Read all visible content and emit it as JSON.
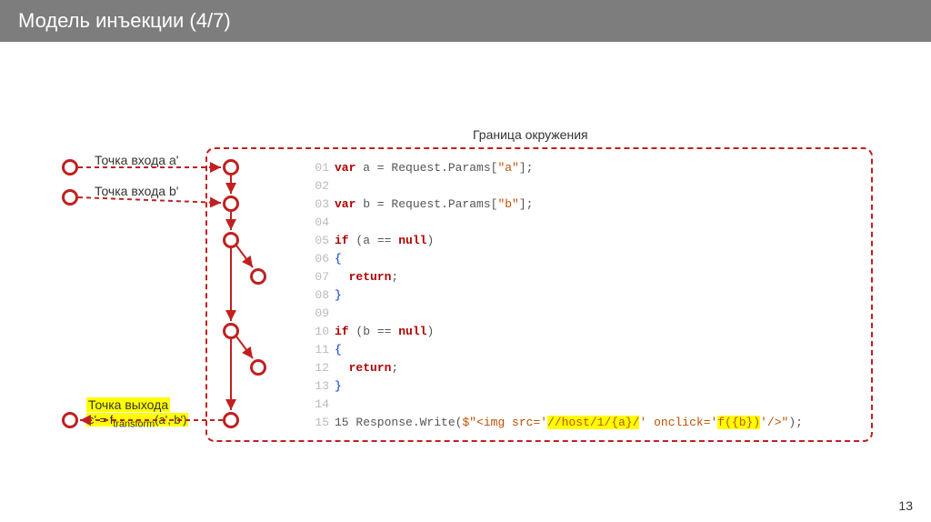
{
  "header": {
    "title": "Модель инъекции (4/7)"
  },
  "slide_number": "13",
  "boundary_label": "Граница окружения",
  "labels": {
    "entry_a": "Точка входа a'",
    "entry_b": "Точка входа b'",
    "exit_c": "Точка выхода",
    "exit_formula": "c' = ftransform(a', b')"
  },
  "code": {
    "l01_a": "01 ",
    "l01_kw": "var",
    "l01_b": " a = Request.Params[",
    "l01_str": "\"a\"",
    "l01_c": "];",
    "l02": "02",
    "l03_a": "03 ",
    "l03_kw": "var",
    "l03_b": " b = Request.Params[",
    "l03_str": "\"b\"",
    "l03_c": "];",
    "l04": "04",
    "l05_a": "05 ",
    "l05_kw": "if",
    "l05_b": " (a == ",
    "l05_kw2": "null",
    "l05_c": ")",
    "l06_a": "06 ",
    "l06_brace": "{",
    "l07_a": "07   ",
    "l07_kw": "return",
    "l07_b": ";",
    "l08_a": "08 ",
    "l08_brace": "}",
    "l09": "09",
    "l10_a": "10 ",
    "l10_kw": "if",
    "l10_b": " (b == ",
    "l10_kw2": "null",
    "l10_c": ")",
    "l11_a": "11 ",
    "l11_brace": "{",
    "l12_a": "12   ",
    "l12_kw": "return",
    "l12_b": ";",
    "l13_a": "13 ",
    "l13_brace": "}",
    "l14": "14",
    "l15_a": "15 Response.Write(",
    "l15_str1": "$\"<img src='",
    "l15_hl1": "//host/1/{a}/",
    "l15_str2": "' onclick='",
    "l15_hl2": "f({b})",
    "l15_str3": "'/>\"",
    "l15_b": ");"
  }
}
